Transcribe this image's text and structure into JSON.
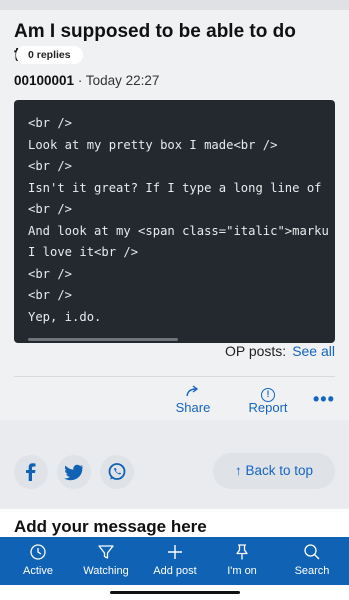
{
  "thread": {
    "title": "Am I supposed to be able to do this?",
    "replies_badge": "0 replies",
    "author": "00100001",
    "separator": " · ",
    "time": "Today 22:27"
  },
  "code_block": {
    "lines": [
      "<br />",
      "Look at my pretty box I made<br />",
      "<br />",
      "Isn't it great? If I type a long line of",
      "<br />",
      "And look at my <span class=\"italic\">marku",
      "I love it<br />",
      "<br />",
      "<br />",
      "Yep, i.do."
    ]
  },
  "op_posts": {
    "label": "OP posts:",
    "link": "See all"
  },
  "actions": {
    "share": "Share",
    "report": "Report",
    "more": "•••",
    "report_glyph": "!"
  },
  "back_to_top": {
    "arrow": "↑",
    "label": "Back to top"
  },
  "add_message": {
    "heading": "Add your message here"
  },
  "bottom_nav": {
    "items": [
      {
        "label": "Active",
        "icon": "clock-icon"
      },
      {
        "label": "Watching",
        "icon": "filter-icon"
      },
      {
        "label": "Add post",
        "icon": "plus-icon"
      },
      {
        "label": "I'm on",
        "icon": "pin-icon"
      },
      {
        "label": "Search",
        "icon": "search-icon"
      }
    ]
  },
  "colors": {
    "accent": "#1565c0",
    "nav_bg": "#0f62b4",
    "code_bg": "#23292f"
  }
}
